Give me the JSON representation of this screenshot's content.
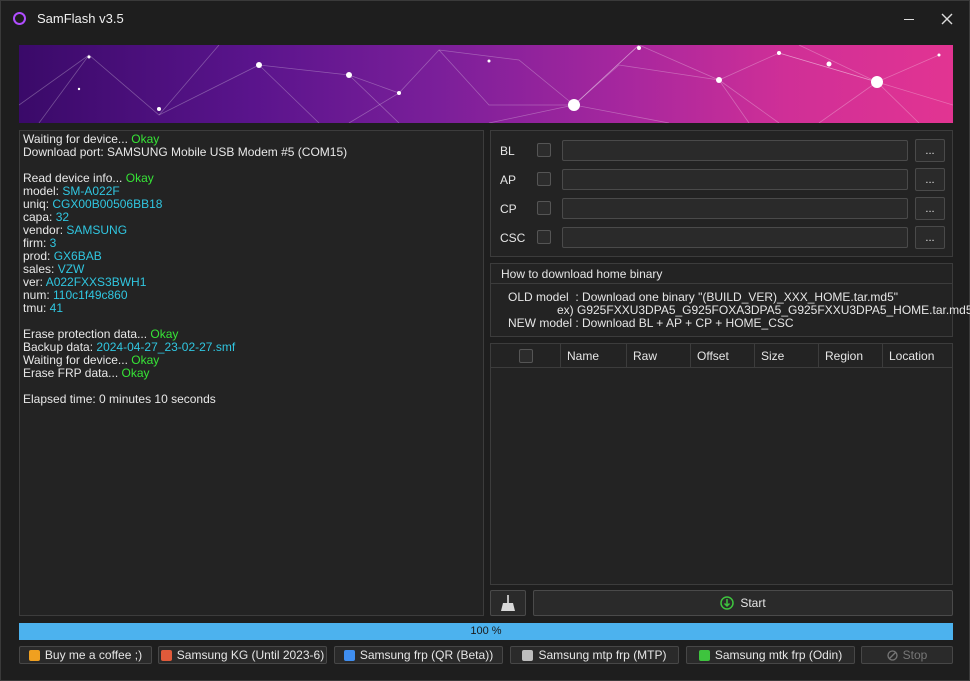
{
  "window": {
    "title": "SamFlash v3.5"
  },
  "log": {
    "lines": [
      [
        {
          "t": "Waiting for device... "
        },
        {
          "t": "Okay",
          "c": "ok"
        }
      ],
      [
        {
          "t": "Download port: SAMSUNG Mobile USB Modem #5 (COM15)"
        }
      ],
      [],
      [
        {
          "t": "Read device info... "
        },
        {
          "t": "Okay",
          "c": "ok"
        }
      ],
      [
        {
          "t": "model: "
        },
        {
          "t": "SM-A022F",
          "c": "val"
        }
      ],
      [
        {
          "t": "uniq: "
        },
        {
          "t": "CGX00B00506BB18",
          "c": "val"
        }
      ],
      [
        {
          "t": "capa: "
        },
        {
          "t": "32",
          "c": "val"
        }
      ],
      [
        {
          "t": "vendor: "
        },
        {
          "t": "SAMSUNG",
          "c": "val"
        }
      ],
      [
        {
          "t": "firm: "
        },
        {
          "t": "3",
          "c": "val"
        }
      ],
      [
        {
          "t": "prod: "
        },
        {
          "t": "GX6BAB",
          "c": "val"
        }
      ],
      [
        {
          "t": "sales: "
        },
        {
          "t": "VZW",
          "c": "val"
        }
      ],
      [
        {
          "t": "ver: "
        },
        {
          "t": "A022FXXS3BWH1",
          "c": "val"
        }
      ],
      [
        {
          "t": "num: "
        },
        {
          "t": "110c1f49c860",
          "c": "val"
        }
      ],
      [
        {
          "t": "tmu: "
        },
        {
          "t": "41",
          "c": "val"
        }
      ],
      [],
      [
        {
          "t": "Erase protection data... "
        },
        {
          "t": "Okay",
          "c": "ok"
        }
      ],
      [
        {
          "t": "Backup data: "
        },
        {
          "t": "2024-04-27_23-02-27.smf",
          "c": "val"
        }
      ],
      [
        {
          "t": "Waiting for device... "
        },
        {
          "t": "Okay",
          "c": "ok"
        }
      ],
      [
        {
          "t": "Erase FRP data... "
        },
        {
          "t": "Okay",
          "c": "ok"
        }
      ],
      [],
      [
        {
          "t": "Elapsed time: 0 minutes 10 seconds"
        }
      ]
    ]
  },
  "files": [
    {
      "label": "BL",
      "value": "",
      "browse": "..."
    },
    {
      "label": "AP",
      "value": "",
      "browse": "..."
    },
    {
      "label": "CP",
      "value": "",
      "browse": "..."
    },
    {
      "label": "CSC",
      "value": "",
      "browse": "..."
    }
  ],
  "info": {
    "title": "How to download home binary",
    "line1": "OLD model  : Download one binary \"(BUILD_VER)_XXX_HOME.tar.md5\"",
    "line2": "ex) G925FXXU3DPA5_G925FOXA3DPA5_G925FXXU3DPA5_HOME.tar.md5",
    "line3": "NEW model : Download BL + AP + CP + HOME_CSC"
  },
  "table": {
    "columns": [
      "Name",
      "Raw",
      "Offset",
      "Size",
      "Region",
      "Location"
    ],
    "rows": []
  },
  "actions": {
    "start_label": "Start"
  },
  "progress": {
    "value": 100,
    "label": "100 %"
  },
  "bottom_buttons": [
    {
      "label": "Buy me a coffee ;)",
      "icon": "coffee-icon",
      "color": "#f0a020"
    },
    {
      "label": "Samsung KG (Until 2023-6)",
      "icon": "briefcase-icon",
      "color": "#e05a3a"
    },
    {
      "label": "Samsung frp (QR (Beta))",
      "icon": "qr-icon",
      "color": "#3f8ef0"
    },
    {
      "label": "Samsung mtp frp (MTP)",
      "icon": "list-icon",
      "color": "#bdbdbd"
    },
    {
      "label": "Samsung mtk frp (Odin)",
      "icon": "android-icon",
      "color": "#3ec43e"
    },
    {
      "label": "Stop",
      "icon": "stop-icon",
      "color": "#777777",
      "disabled": true
    }
  ]
}
